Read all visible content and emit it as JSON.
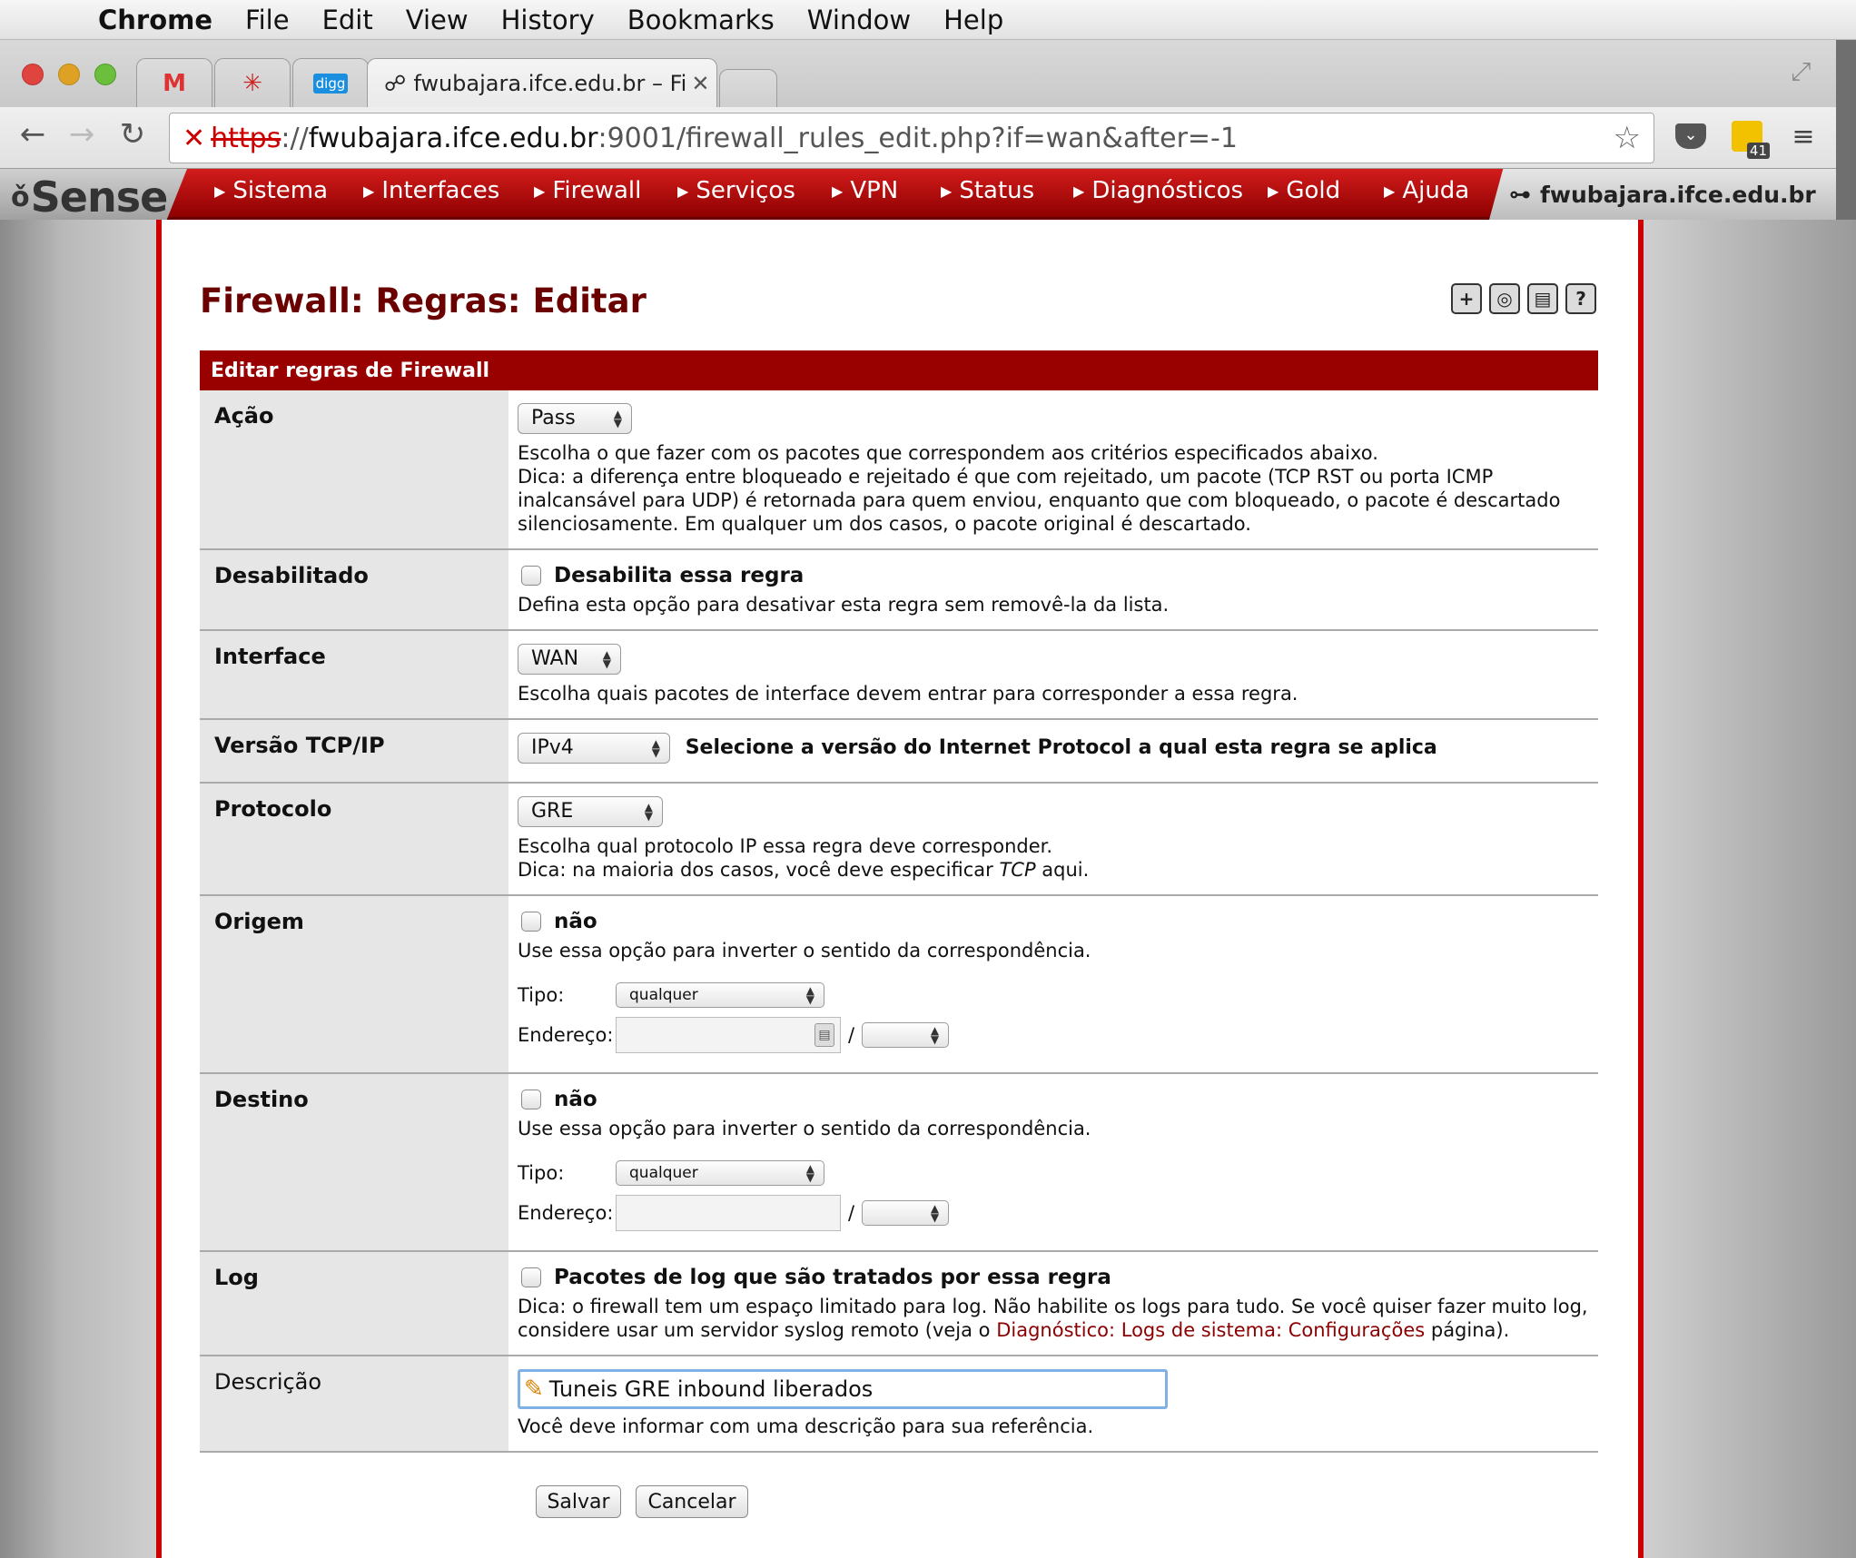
{
  "menubar": {
    "app": "Chrome",
    "items": [
      "File",
      "Edit",
      "View",
      "History",
      "Bookmarks",
      "Window",
      "Help"
    ]
  },
  "browser": {
    "tabs": [
      {
        "icon": "gmail-icon",
        "glyph": "M"
      },
      {
        "icon": "asterisk-icon",
        "glyph": "✳"
      },
      {
        "icon": "digg-icon",
        "glyph": "digg"
      },
      {
        "title": "fwubajara.ifce.edu.br – Fire",
        "icon": "pfsense-icon"
      }
    ],
    "url_scheme": "https",
    "url_host": "fwubajara.ifce.edu.br",
    "url_rest": ":9001/firewall_rules_edit.php?if=wan&after=-1",
    "extension_badge": "41"
  },
  "pf_nav": {
    "logo": "Sense",
    "items": [
      "Sistema",
      "Interfaces",
      "Firewall",
      "Serviços",
      "VPN",
      "Status",
      "Diagnósticos",
      "Gold",
      "Ajuda"
    ],
    "hostname": "fwubajara.ifce.edu.br"
  },
  "page": {
    "title": "Firewall: Regras: Editar",
    "panel_title": "Editar regras de Firewall"
  },
  "form": {
    "acao": {
      "label": "Ação",
      "value": "Pass",
      "help1": "Escolha o que fazer com os pacotes que correspondem aos critérios especificados abaixo.",
      "help2": "Dica: a diferença entre bloqueado e rejeitado é que com rejeitado, um pacote (TCP RST ou porta ICMP inalcansável para UDP) é retornada para quem enviou, enquanto que com bloqueado, o pacote é descartado silenciosamente. Em qualquer um dos casos, o pacote original é descartado."
    },
    "desabilitado": {
      "label": "Desabilitado",
      "checkbox_label": "Desabilita essa regra",
      "help": "Defina esta opção para desativar esta regra sem removê-la da lista."
    },
    "interface": {
      "label": "Interface",
      "value": "WAN",
      "help": "Escolha quais pacotes de interface devem entrar para corresponder a essa regra."
    },
    "versao": {
      "label": "Versão TCP/IP",
      "value": "IPv4",
      "help": "Selecione a versão do Internet Protocol a qual esta regra se aplica"
    },
    "protocolo": {
      "label": "Protocolo",
      "value": "GRE",
      "help1": "Escolha qual protocolo IP essa regra deve corresponder.",
      "help2_pre": "Dica: na maioria dos casos, você deve especificar ",
      "help2_em": "TCP",
      "help2_post": "  aqui."
    },
    "origem": {
      "label": "Origem",
      "not_label": "não",
      "help": "Use essa opção para inverter o sentido da correspondência.",
      "tipo_label": "Tipo:",
      "tipo_value": "qualquer",
      "endereco_label": "Endereço:",
      "slash": "/"
    },
    "destino": {
      "label": "Destino",
      "not_label": "não",
      "help": "Use essa opção para inverter o sentido da correspondência.",
      "tipo_label": "Tipo:",
      "tipo_value": "qualquer",
      "endereco_label": "Endereço:",
      "slash": "/"
    },
    "log": {
      "label": "Log",
      "checkbox_label": "Pacotes de log que são tratados por essa regra",
      "help_pre": "Dica: o firewall tem um espaço limitado para log. Não habilite os logs para tudo. Se você quiser fazer muito log, considere usar um servidor syslog remoto (veja o ",
      "help_link": "Diagnóstico: Logs de sistema: Configurações",
      "help_post": " página)."
    },
    "descricao": {
      "label": "Descrição",
      "value": "Tuneis GRE inbound liberados",
      "help": "Você deve informar com uma descrição para sua referência."
    }
  },
  "buttons": {
    "save": "Salvar",
    "cancel": "Cancelar"
  },
  "colors": {
    "accent_red": "#990000",
    "title_red": "#6b0000",
    "label_bg": "#e6e6e6"
  }
}
